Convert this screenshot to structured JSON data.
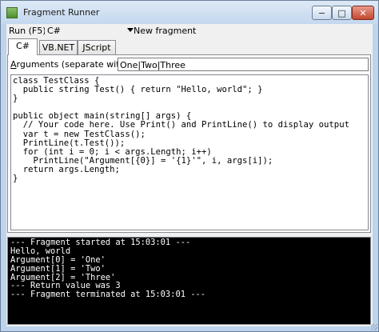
{
  "window": {
    "title": "Fragment Runner",
    "controls": {
      "minimize": "−",
      "maximize": "□",
      "close": "✕"
    }
  },
  "toolbar": {
    "run_label": "Run (F5)",
    "language": "C#",
    "new_fragment_label": "New fragment"
  },
  "tabs": [
    {
      "label": "C#",
      "active": true
    },
    {
      "label": "VB.NET",
      "active": false
    },
    {
      "label": "JScript",
      "active": false
    }
  ],
  "arguments": {
    "label_prefix": "A",
    "label_rest": "rguments (separate with |):",
    "value": "One|Two|Three"
  },
  "code_lines": [
    "class TestClass {",
    "  public string Test() { return \"Hello, world\"; }",
    "}",
    "",
    "public object main(string[] args) {",
    "  // Your code here. Use Print() and PrintLine() to display output",
    "  var t = new TestClass();",
    "  PrintLine(t.Test());",
    "  for (int i = 0; i < args.Length; i++)",
    "    PrintLine(\"Argument[{0}] = '{1}'\", i, args[i]);",
    "  return args.Length;",
    "}"
  ],
  "output_lines": [
    "--- Fragment started at 15:03:01 ---",
    "Hello, world",
    "Argument[0] = 'One'",
    "Argument[1] = 'Two'",
    "Argument[2] = 'Three'",
    "--- Return value was 3",
    "--- Fragment terminated at 15:03:01 ---"
  ],
  "colors": {
    "titlebar": "#c3d7ee",
    "console_bg": "#000000",
    "console_fg": "#ffffff",
    "close_button": "#c4452c"
  }
}
